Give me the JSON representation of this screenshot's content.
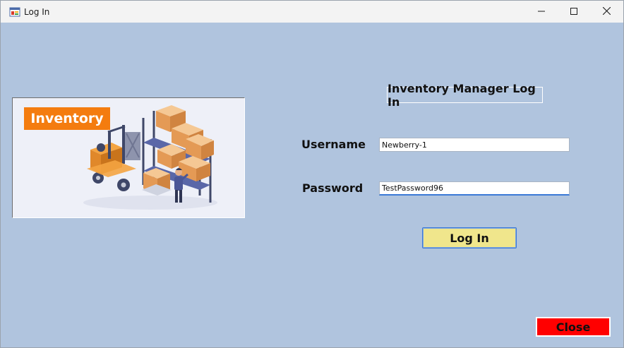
{
  "window": {
    "title": "Log In",
    "icons": {
      "app": "form-icon",
      "minimize": "minimize-icon",
      "maximize": "maximize-icon",
      "close": "close-icon"
    }
  },
  "picture": {
    "badge_text": "Inventory",
    "badge_color": "#f47c0f",
    "illustration": "warehouse-forklift-illustration"
  },
  "form": {
    "heading": "Inventory Manager Log In",
    "username_label": "Username",
    "username_value": "Newberry-1",
    "password_label": "Password",
    "password_value": "TestPassword96",
    "login_button": "Log In",
    "close_button": "Close"
  },
  "colors": {
    "background": "#b0c4de",
    "login_button": "#f0e68c",
    "close_button": "#ff0000",
    "focus_accent": "#3b79d6"
  }
}
